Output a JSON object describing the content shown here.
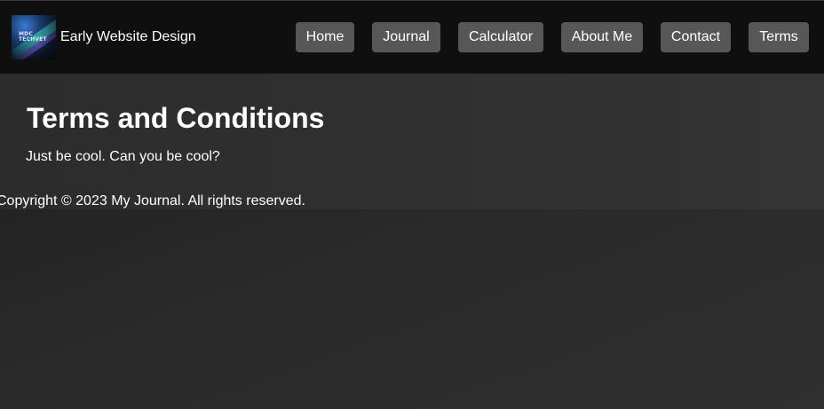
{
  "header": {
    "logo": {
      "icon": "mdc-techvet-logo",
      "text_line1": "MDC",
      "text_line2": "TECHVET"
    },
    "site_title": "Early Website Design",
    "nav": [
      {
        "label": "Home"
      },
      {
        "label": "Journal"
      },
      {
        "label": "Calculator"
      },
      {
        "label": "About Me"
      },
      {
        "label": "Contact"
      },
      {
        "label": "Terms"
      }
    ]
  },
  "main": {
    "title": "Terms and Conditions",
    "body": "Just be cool. Can you be cool?"
  },
  "footer": {
    "copyright": "Copyright © 2023 My Journal. All rights reserved."
  },
  "colors": {
    "header_bg": "#0f0f0f",
    "nav_button_bg": "#575757",
    "page_bg": "#262626",
    "text": "#ffffff"
  }
}
